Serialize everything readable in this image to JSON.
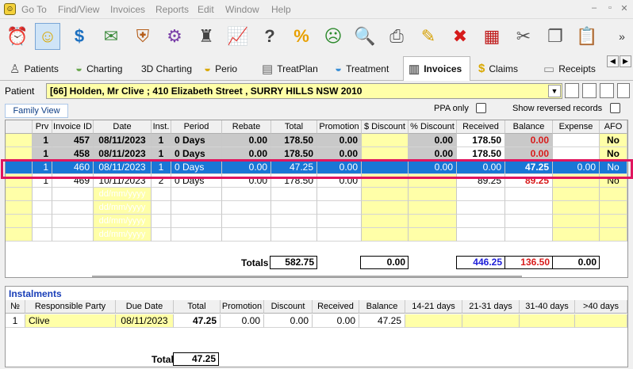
{
  "menu": [
    "Go To",
    "Find/View",
    "Invoices",
    "Reports",
    "Edit",
    "Window",
    "Help"
  ],
  "window_controls": [
    "–",
    "▫",
    "✕"
  ],
  "toolbar_icons": [
    {
      "name": "appointment-book-icon",
      "glyph": "⏰"
    },
    {
      "name": "smiley-icon",
      "glyph": "☺"
    },
    {
      "name": "dollar-icon",
      "glyph": "$"
    },
    {
      "name": "envelope-icon",
      "glyph": "✉"
    },
    {
      "name": "shield-icon",
      "glyph": "⛨"
    },
    {
      "name": "gears-icon",
      "glyph": "⚙"
    },
    {
      "name": "dental-chair-icon",
      "glyph": "♜"
    },
    {
      "name": "chart-growth-icon",
      "glyph": "📈"
    },
    {
      "name": "question-icon",
      "glyph": "?"
    },
    {
      "name": "percent-icon",
      "glyph": "%"
    },
    {
      "name": "face-sad-icon",
      "glyph": "☹"
    },
    {
      "name": "magnifier-icon",
      "glyph": "🔍"
    },
    {
      "name": "printer-icon",
      "glyph": "⎙"
    },
    {
      "name": "pencil-icon",
      "glyph": "✎"
    },
    {
      "name": "delete-icon",
      "glyph": "✖"
    },
    {
      "name": "calendar-icon",
      "glyph": "▦"
    },
    {
      "name": "scissors-icon",
      "glyph": "✂"
    },
    {
      "name": "copy-icon",
      "glyph": "❐"
    },
    {
      "name": "paste-icon",
      "glyph": "📋"
    },
    {
      "name": "more-icon",
      "glyph": "»"
    }
  ],
  "tabs": [
    {
      "label": "Patients",
      "icon": "person-icon",
      "glyph": "♙"
    },
    {
      "label": "Charting",
      "icon": "tooth-icon",
      "glyph": "◒"
    },
    {
      "label": "3D Charting",
      "icon": "",
      "glyph": ""
    },
    {
      "label": "Perio",
      "icon": "tooth-gold-icon",
      "glyph": "◒"
    },
    {
      "label": "TreatPlan",
      "icon": "clipboard-icon",
      "glyph": "▤"
    },
    {
      "label": "Treatment",
      "icon": "tooth-blue-icon",
      "glyph": "◒"
    },
    {
      "label": "Invoices",
      "icon": "printer-stack-icon",
      "glyph": "▥"
    },
    {
      "label": "Claims",
      "icon": "dollar-icon",
      "glyph": "$"
    },
    {
      "label": "Receipts",
      "icon": "receipt-icon",
      "glyph": "▭"
    }
  ],
  "patient": {
    "label": "Patient",
    "value": "[66] Holden, Mr Clive ; 410 Elizabeth Street , SURRY HILLS NSW 2010"
  },
  "family_view_label": "Family View",
  "ppa_only_label": "PPA only",
  "show_reversed_label": "Show reversed records",
  "invoices": {
    "headers": [
      "Prv",
      "Invoice ID",
      "Date",
      "Inst.",
      "Period",
      "Rebate",
      "Total",
      "Promotion",
      "$ Discount",
      "% Discount",
      "Received",
      "Balance",
      "Expense",
      "AFO"
    ],
    "rows": [
      {
        "prv": "1",
        "id": "457",
        "date": "08/11/2023",
        "inst": "1",
        "period": "0 Days",
        "rebate": "0.00",
        "total": "178.50",
        "promotion": "0.00",
        "dollar_discount": "",
        "pct_discount": "0.00",
        "received": "178.50",
        "balance": "0.00",
        "expense": "",
        "afo": "No"
      },
      {
        "prv": "1",
        "id": "458",
        "date": "08/11/2023",
        "inst": "1",
        "period": "0 Days",
        "rebate": "0.00",
        "total": "178.50",
        "promotion": "0.00",
        "dollar_discount": "",
        "pct_discount": "0.00",
        "received": "178.50",
        "balance": "0.00",
        "expense": "",
        "afo": "No"
      },
      {
        "prv": "1",
        "id": "460",
        "date": "08/11/2023",
        "inst": "1",
        "period": "0 Days",
        "rebate": "0.00",
        "total": "47.25",
        "promotion": "0.00",
        "dollar_discount": "",
        "pct_discount": "0.00",
        "received": "0.00",
        "balance": "47.25",
        "expense": "0.00",
        "afo": "No"
      },
      {
        "prv": "1",
        "id": "469",
        "date": "10/11/2023",
        "inst": "2",
        "period": "0 Days",
        "rebate": "0.00",
        "total": "178.50",
        "promotion": "0.00",
        "dollar_discount": "",
        "pct_discount": "",
        "received": "89.25",
        "balance": "89.25",
        "expense": "",
        "afo": "No"
      }
    ],
    "date_placeholder": "dd/mm/yyyy",
    "totals": {
      "label": "Totals",
      "total": "582.75",
      "dollar_discount": "0.00",
      "received": "446.25",
      "balance": "136.50",
      "expense": "0.00"
    }
  },
  "instalments": {
    "title": "Instalments",
    "headers": [
      "№",
      "Responsible Party",
      "Due Date",
      "Total",
      "Promotion",
      "Discount",
      "Received",
      "Balance",
      "14-21 days",
      "21-31 days",
      "31-40 days",
      ">40 days"
    ],
    "rows": [
      {
        "no": "1",
        "party": "Clive",
        "due": "08/11/2023",
        "total": "47.25",
        "promotion": "0.00",
        "discount": "0.00",
        "received": "0.00",
        "balance": "47.25"
      }
    ],
    "total_label": "Total",
    "total_value": "47.25"
  },
  "colors": {
    "accent_row": "#1976d6",
    "highlight": "#e0155e",
    "yellow": "#ffffa8",
    "balance_red": "#d81b1b",
    "received_blue": "#1d1dd8"
  }
}
